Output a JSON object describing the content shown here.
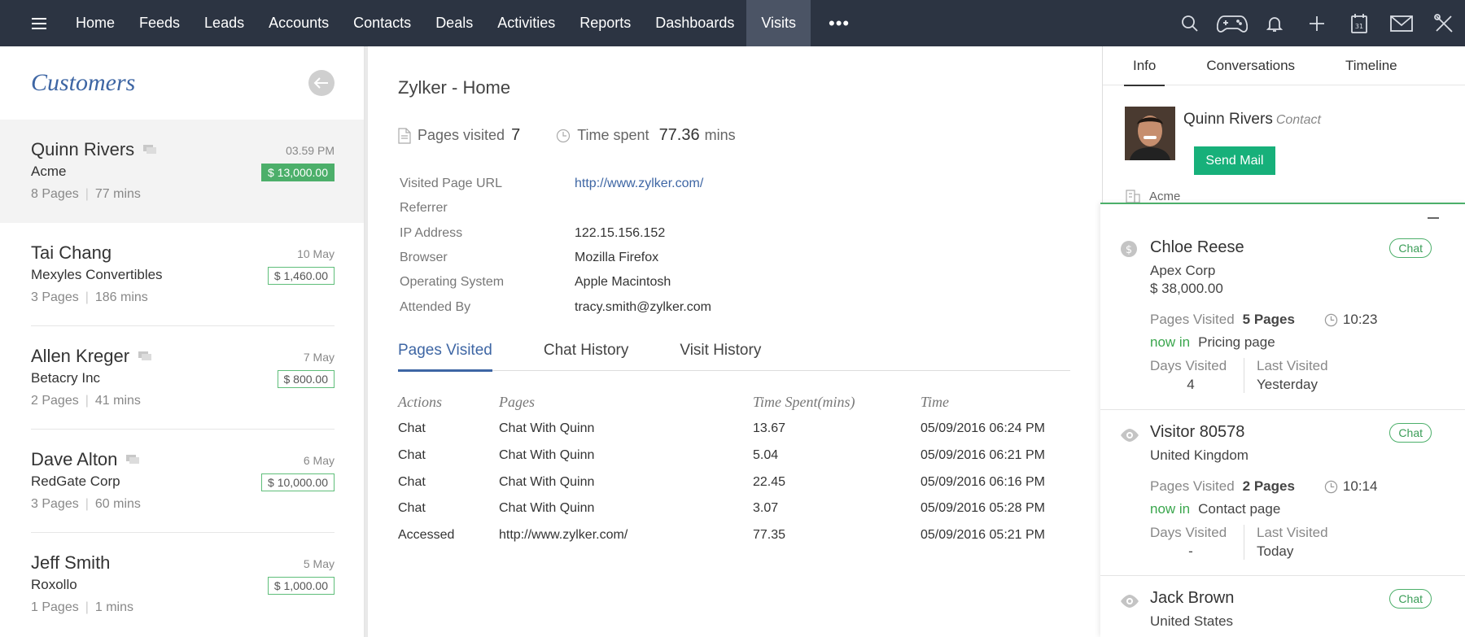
{
  "nav": {
    "items": [
      "Home",
      "Feeds",
      "Leads",
      "Accounts",
      "Contacts",
      "Deals",
      "Activities",
      "Reports",
      "Dashboards",
      "Visits"
    ],
    "active": "Visits",
    "more": "•••",
    "icons": [
      "search-icon",
      "gamepad-icon",
      "bell-icon",
      "plus-icon",
      "calendar-icon",
      "mail-icon",
      "tools-icon"
    ],
    "calendar_day": "31"
  },
  "customers": {
    "title": "Customers",
    "items": [
      {
        "name": "Quinn Rivers",
        "company": "Acme",
        "pages": "8 Pages",
        "mins": "77 mins",
        "time": "03.59 PM",
        "amount": "$ 13,000.00"
      },
      {
        "name": "Tai Chang",
        "company": "Mexyles Convertibles",
        "pages": "3 Pages",
        "mins": "186 mins",
        "time": "10 May",
        "amount": "$ 1,460.00"
      },
      {
        "name": "Allen Kreger",
        "company": "Betacry Inc",
        "pages": "2 Pages",
        "mins": "41 mins",
        "time": "7 May",
        "amount": "$ 800.00"
      },
      {
        "name": "Dave Alton",
        "company": "RedGate Corp",
        "pages": "3 Pages",
        "mins": "60 mins",
        "time": "6 May",
        "amount": "$ 10,000.00"
      },
      {
        "name": "Jeff Smith",
        "company": "Roxollo",
        "pages": "1 Pages",
        "mins": "1 mins",
        "time": "5 May",
        "amount": "$ 1,000.00"
      }
    ]
  },
  "visit": {
    "title": "Zylker - Home",
    "pages_label": "Pages visited",
    "pages_value": "7",
    "time_label": "Time spent",
    "time_value": "77.36",
    "time_unit": "mins",
    "details": [
      {
        "label": "Visited Page URL",
        "value": "http://www.zylker.com/"
      },
      {
        "label": "Referrer",
        "value": ""
      },
      {
        "label": "IP Address",
        "value": "122.15.156.152"
      },
      {
        "label": "Browser",
        "value": "Mozilla Firefox"
      },
      {
        "label": "Operating System",
        "value": "Apple Macintosh"
      },
      {
        "label": "Attended By",
        "value": "tracy.smith@zylker.com"
      }
    ],
    "tabs": [
      "Pages Visited",
      "Chat History",
      "Visit History"
    ],
    "table": {
      "headers": [
        "Actions",
        "Pages",
        "Time Spent(mins)",
        "Time"
      ],
      "rows": [
        [
          "Chat",
          "Chat With Quinn",
          "13.67",
          "05/09/2016 06:24 PM"
        ],
        [
          "Chat",
          "Chat With Quinn",
          "5.04",
          "05/09/2016 06:21 PM"
        ],
        [
          "Chat",
          "Chat With Quinn",
          "22.45",
          "05/09/2016 06:16 PM"
        ],
        [
          "Chat",
          "Chat With Quinn",
          "3.07",
          "05/09/2016 05:28 PM"
        ],
        [
          "Accessed",
          "http://www.zylker.com/",
          "77.35",
          "05/09/2016 05:21 PM"
        ]
      ]
    }
  },
  "info": {
    "tabs": [
      "Info",
      "Conversations",
      "Timeline"
    ],
    "name": "Quinn Rivers",
    "role": "Contact",
    "send_mail": "Send Mail",
    "account": "Acme"
  },
  "visitors": [
    {
      "name": "Chloe Reese",
      "line1": "Apex Corp",
      "line2": "$ 38,000.00",
      "icon": "dollar-icon",
      "chat": "Chat",
      "pages_label": "Pages Visited",
      "pages": "5 Pages",
      "time": "10:23",
      "now_label": "now in",
      "now_page": "Pricing page",
      "days_label": "Days Visited",
      "days": "4",
      "last_label": "Last Visited",
      "last": "Yesterday"
    },
    {
      "name": "Visitor 80578",
      "line1": "United Kingdom",
      "icon": "eye-icon",
      "chat": "Chat",
      "pages_label": "Pages Visited",
      "pages": "2 Pages",
      "time": "10:14",
      "now_label": "now in",
      "now_page": "Contact page",
      "days_label": "Days Visited",
      "days": "-",
      "last_label": "Last Visited",
      "last": "Today"
    },
    {
      "name": "Jack Brown",
      "line1": "United States",
      "icon": "eye-icon",
      "chat": "Chat"
    }
  ]
}
